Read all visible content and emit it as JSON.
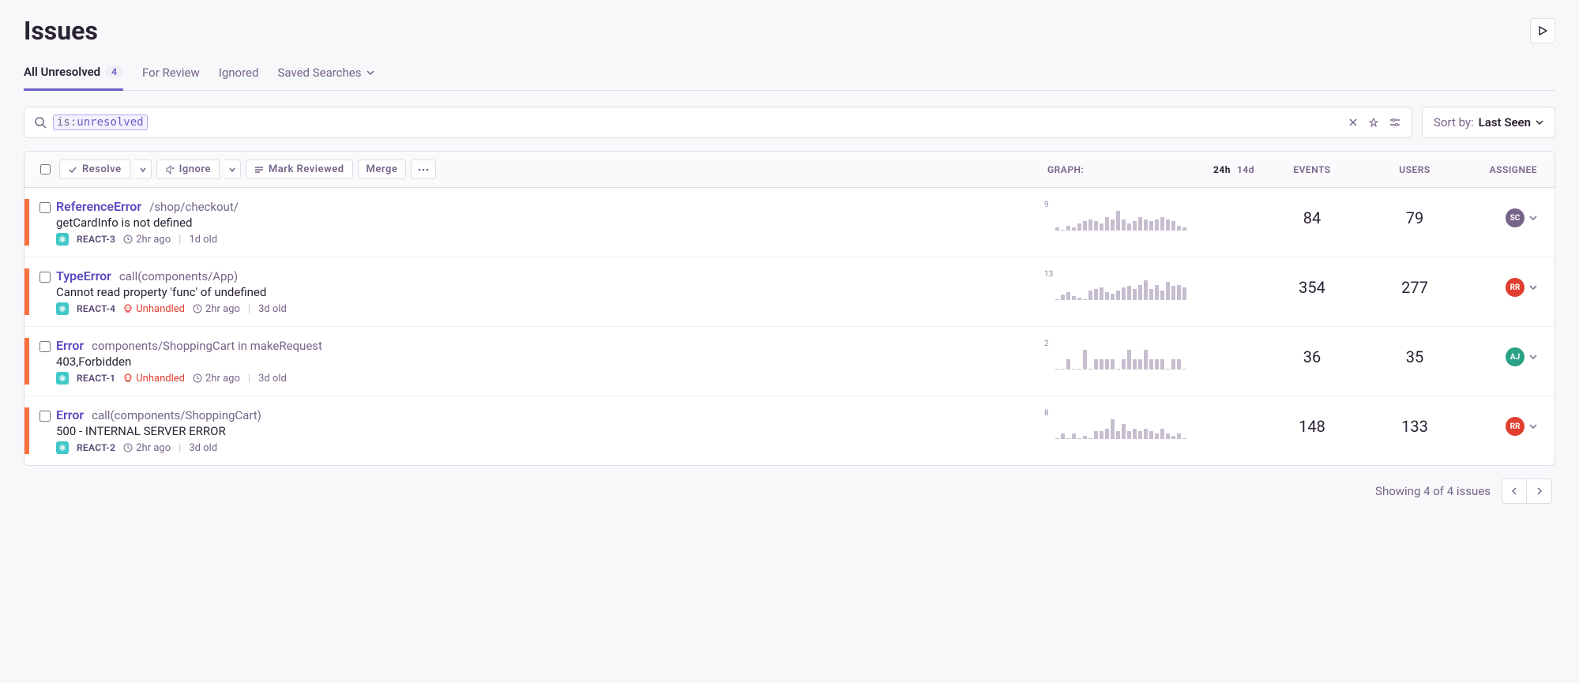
{
  "page_title": "Issues",
  "tabs": {
    "all_unresolved": {
      "label": "All Unresolved",
      "count": "4"
    },
    "for_review": {
      "label": "For Review"
    },
    "ignored": {
      "label": "Ignored"
    },
    "saved_searches": {
      "label": "Saved Searches"
    }
  },
  "search": {
    "token_key": "is:",
    "token_value": "unresolved"
  },
  "sort": {
    "prefix": "Sort by:",
    "value": "Last Seen"
  },
  "bulk_actions": {
    "resolve": "Resolve",
    "ignore": "Ignore",
    "mark_reviewed": "Mark Reviewed",
    "merge": "Merge"
  },
  "columns": {
    "graph": "GRAPH:",
    "range_24h": "24h",
    "range_14d": "14d",
    "events": "EVENTS",
    "users": "USERS",
    "assignee": "ASSIGNEE"
  },
  "issues": [
    {
      "name": "ReferenceError",
      "location": "/shop/checkout/",
      "message": "getCardInfo is not defined",
      "project_id": "REACT-3",
      "unhandled": false,
      "time": "2hr ago",
      "age": "1d old",
      "spark_max": "9",
      "spark": [
        1,
        0,
        2,
        1,
        3,
        4,
        5,
        4,
        3,
        6,
        5,
        9,
        5,
        3,
        4,
        6,
        5,
        4,
        5,
        6,
        5,
        4,
        2,
        1
      ],
      "events": "84",
      "users": "79",
      "assignee": {
        "initials": "SC",
        "color": "#776589"
      }
    },
    {
      "name": "TypeError",
      "location": "call(components/App)",
      "message": "Cannot read property 'func' of undefined",
      "project_id": "REACT-4",
      "unhandled": true,
      "time": "2hr ago",
      "age": "3d old",
      "spark_max": "13",
      "spark": [
        0,
        3,
        5,
        2,
        1,
        0,
        6,
        7,
        8,
        5,
        4,
        6,
        8,
        9,
        7,
        10,
        13,
        7,
        10,
        6,
        12,
        9,
        10,
        8
      ],
      "events": "354",
      "users": "277",
      "assignee": {
        "initials": "RR",
        "color": "#e03e2f"
      }
    },
    {
      "name": "Error",
      "location": "components/ShoppingCart in makeRequest",
      "message": "403,Forbidden",
      "project_id": "REACT-1",
      "unhandled": true,
      "time": "2hr ago",
      "age": "3d old",
      "spark_max": "2",
      "spark": [
        0,
        0,
        1,
        0,
        0,
        2,
        0,
        1,
        1,
        1,
        1,
        0,
        1,
        2,
        1,
        1,
        2,
        1,
        1,
        1,
        0,
        1,
        1,
        0
      ],
      "events": "36",
      "users": "35",
      "assignee": {
        "initials": "AJ",
        "color": "#2ba185"
      }
    },
    {
      "name": "Error",
      "location": "call(components/ShoppingCart)",
      "message": "500 - INTERNAL SERVER ERROR",
      "project_id": "REACT-2",
      "unhandled": false,
      "time": "2hr ago",
      "age": "3d old",
      "spark_max": "8",
      "spark": [
        0,
        2,
        0,
        2,
        0,
        1,
        0,
        3,
        3,
        4,
        8,
        3,
        6,
        3,
        4,
        3,
        4,
        3,
        2,
        4,
        2,
        1,
        2,
        0
      ],
      "events": "148",
      "users": "133",
      "assignee": {
        "initials": "RR",
        "color": "#e03e2f"
      }
    }
  ],
  "unhandled_label": "Unhandled",
  "footer": {
    "summary": "Showing 4 of 4 issues"
  }
}
